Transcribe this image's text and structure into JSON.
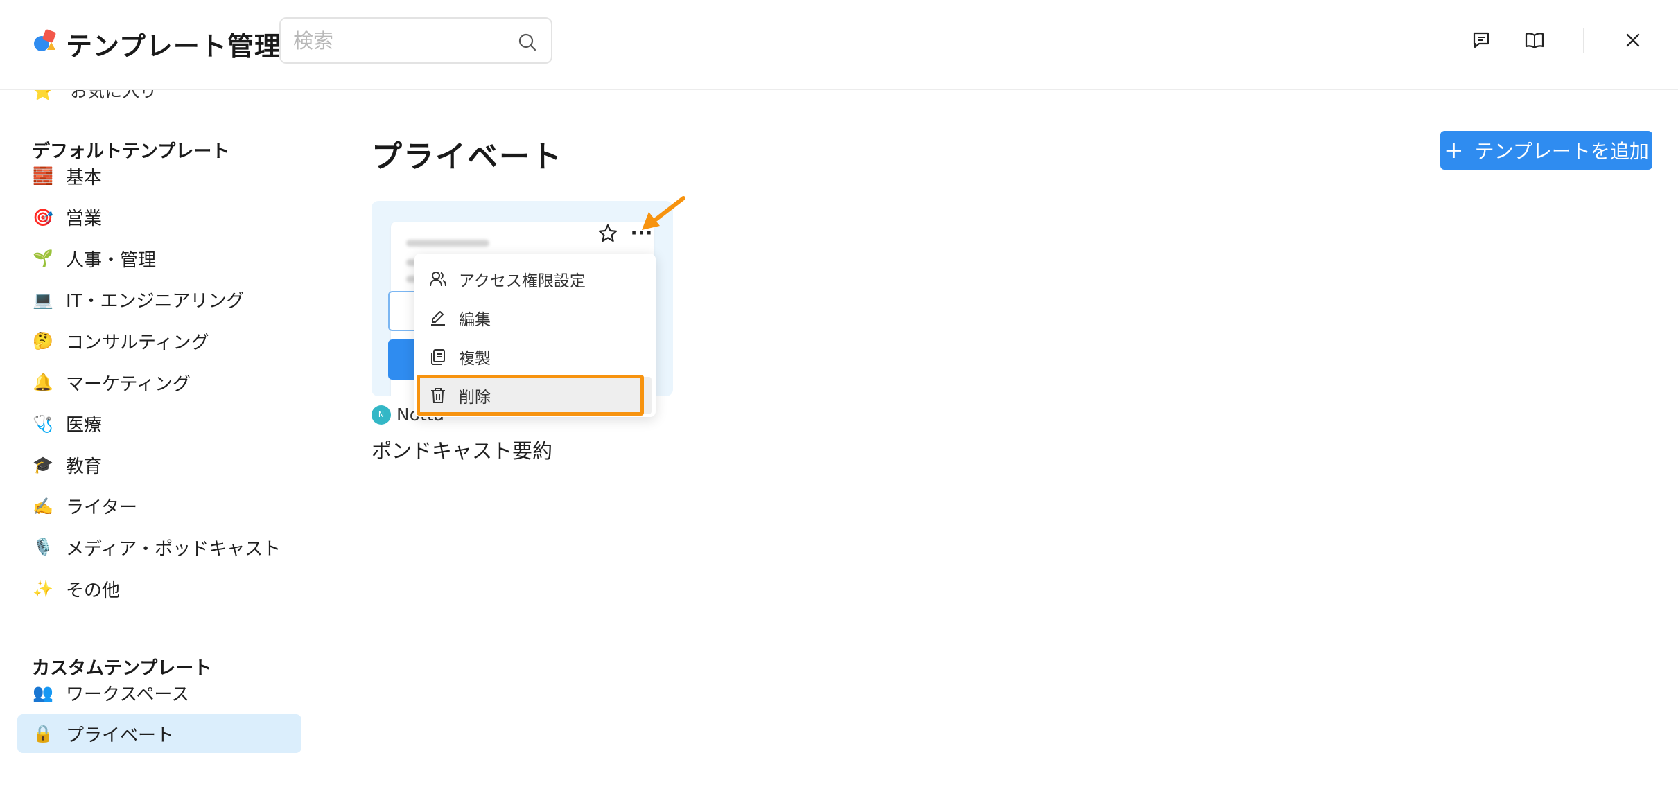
{
  "header": {
    "title": "テンプレート管理",
    "search_placeholder": "検索",
    "icons": [
      "feedback-icon",
      "book-icon",
      "close-icon"
    ]
  },
  "sidebar": {
    "partial_item": "お気に入り",
    "default_section_title": "デフォルトテンプレート",
    "default_items": [
      {
        "emoji": "🧱",
        "label": "基本"
      },
      {
        "emoji": "🎯",
        "label": "営業"
      },
      {
        "emoji": "🌱",
        "label": "人事・管理"
      },
      {
        "emoji": "💻",
        "label": "IT・エンジニアリング"
      },
      {
        "emoji": "🤔",
        "label": "コンサルティング"
      },
      {
        "emoji": "🔔",
        "label": "マーケティング"
      },
      {
        "emoji": "🩺",
        "label": " 医療"
      },
      {
        "emoji": "🎓",
        "label": "教育"
      },
      {
        "emoji": "✍️",
        "label": "ライター"
      },
      {
        "emoji": "🎙️",
        "label": "メディア・ポッドキャスト"
      },
      {
        "emoji": "✨",
        "label": "その他"
      }
    ],
    "custom_section_title": "カスタムテンプレート",
    "custom_items": [
      {
        "emoji": "👥",
        "label": "ワークスペース"
      },
      {
        "emoji": "🔒",
        "label": "プライベート",
        "active": true
      }
    ]
  },
  "main": {
    "title": "プライベート",
    "add_button_label": "テンプレートを追加",
    "card": {
      "owner_initial": "N",
      "owner": "Notta",
      "title": "ポンドキャスト要約"
    },
    "menu": {
      "items": [
        {
          "icon": "users-icon",
          "label": "アクセス権限設定"
        },
        {
          "icon": "edit-icon",
          "label": "編集"
        },
        {
          "icon": "copy-icon",
          "label": "複製"
        },
        {
          "icon": "trash-icon",
          "label": "削除",
          "highlighted": true
        }
      ]
    }
  },
  "colors": {
    "accent": "#2f8cf0",
    "active_bg": "#dbeefc",
    "highlight": "#f7930f",
    "card_bg": "#eaf5fd"
  }
}
